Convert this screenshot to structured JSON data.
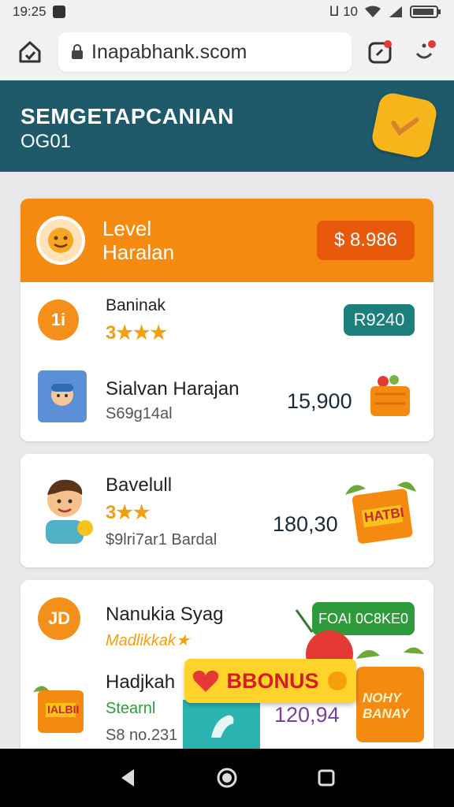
{
  "status": {
    "time": "19:25",
    "indicators": "ⵡ 10"
  },
  "browser": {
    "url": "Inapabhank.scom"
  },
  "hero": {
    "title": "SEMGETAPCANIAN",
    "subtitle": "OG01"
  },
  "card1": {
    "header": {
      "line1": "Level",
      "line2": "Haralan",
      "amount": "$ 8.986"
    },
    "rows": [
      {
        "icon_text": "1i",
        "name": "Baninak",
        "stars": "3★★★",
        "pill": "R9240"
      },
      {
        "name": "Sialvan Harajan",
        "sub": "S69g14al",
        "value": "15,900"
      }
    ]
  },
  "card2": {
    "name": "Bavelull",
    "stars": "3★★",
    "sub": "$9lri7ar1 Bardal",
    "value": "180,30",
    "badge": "HATBI"
  },
  "card3": {
    "row1": {
      "icon_text": "JD",
      "name": "Nanukia Syag",
      "sub": "Madlikkak★",
      "pill": "FOAI 0C8KE0"
    },
    "row2": {
      "name": "Hadjkah",
      "sub1": "Stearnl",
      "sub2": "S8 no.231",
      "value": "120,94"
    },
    "bonus_label": "BBONUS",
    "tag_left": "IALBII",
    "tag_right": "NOHY BANAY"
  },
  "colors": {
    "accent": "#f58a11",
    "teal": "#1e5a6a",
    "pill_teal": "#1b7f7b",
    "pill_green": "#2e9b3a"
  }
}
